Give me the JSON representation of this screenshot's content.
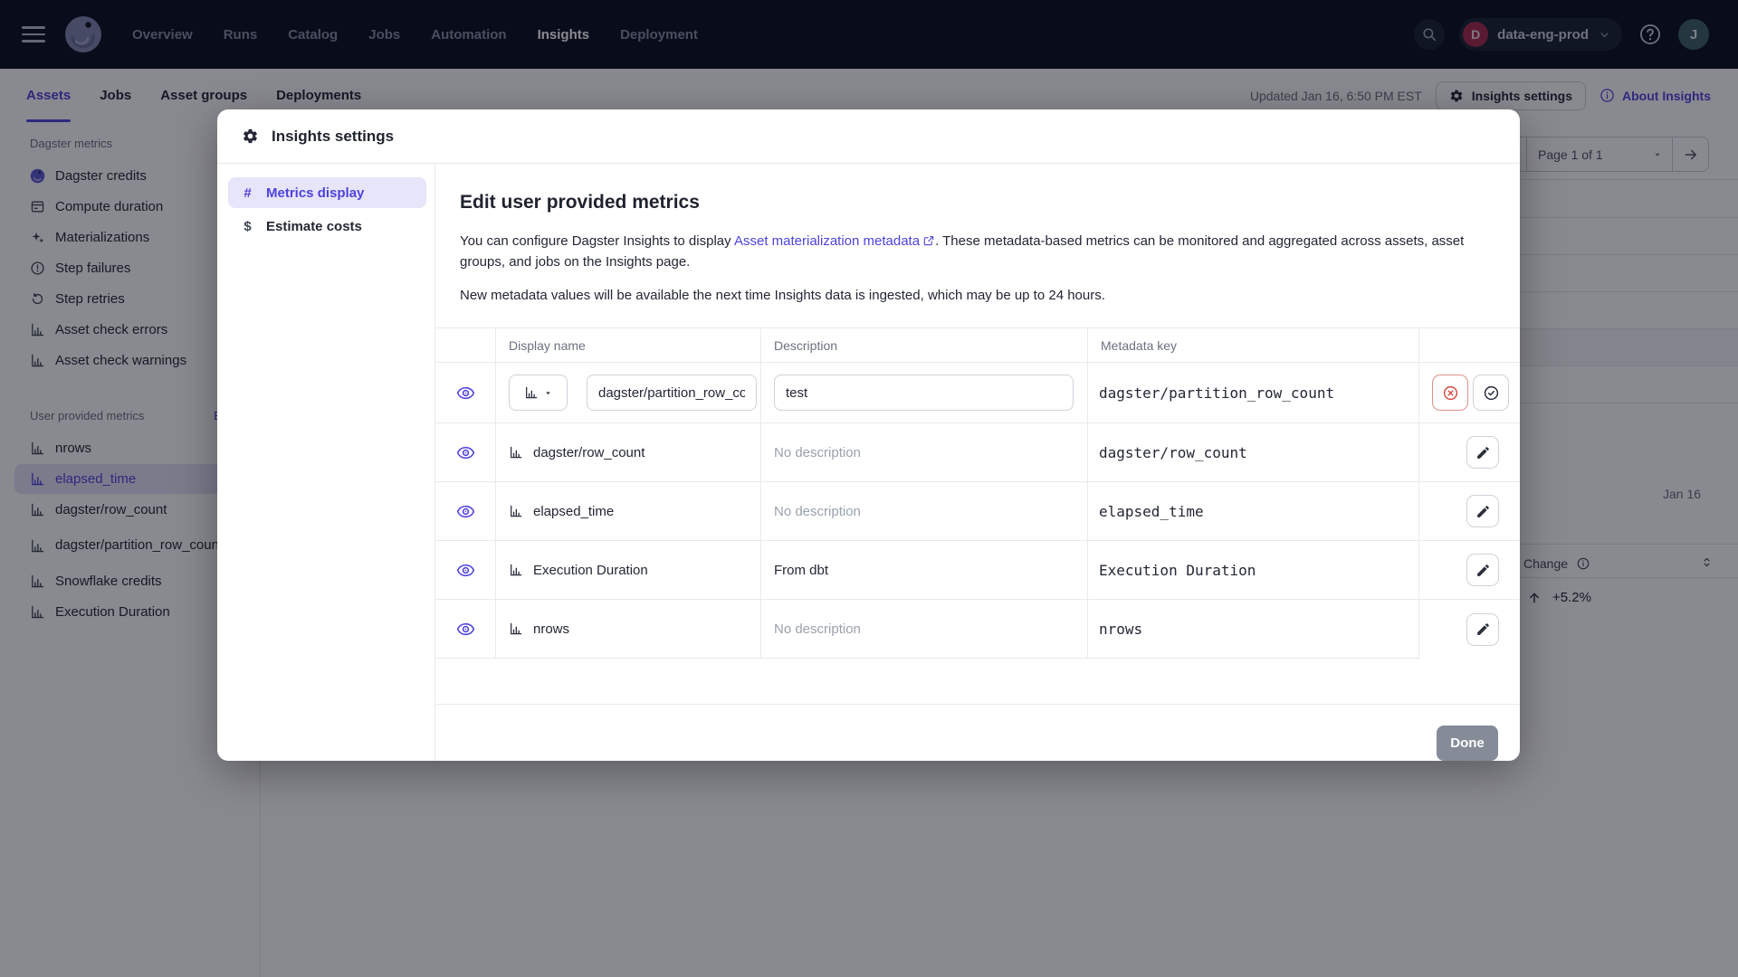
{
  "colors": {
    "accent": "#4f43dd",
    "accent_soft": "#e7e5fa",
    "danger": "#d8493e",
    "topnav_bg": "#0b0f1d",
    "org_badge": "#a62b4c",
    "avatar": "#3e6168",
    "done_button": "#858c98",
    "divider": "#e7e9ec"
  },
  "icons": {
    "logo": "dagster-octopus",
    "search": "magnifier",
    "help": "question-circle",
    "metric": "bar-chart",
    "visible": "eye",
    "edit": "pencil",
    "cancel": "circle-x",
    "confirm": "circle-check"
  },
  "topnav": {
    "items": [
      "Overview",
      "Runs",
      "Catalog",
      "Jobs",
      "Automation",
      "Insights",
      "Deployment"
    ],
    "active": "Insights",
    "org": {
      "initial": "D",
      "name": "data-eng-prod"
    },
    "avatar_initial": "J"
  },
  "tabsbar": {
    "tabs": [
      "Assets",
      "Jobs",
      "Asset groups",
      "Deployments"
    ],
    "active": "Assets",
    "updated": "Updated Jan 16, 6:50 PM EST",
    "settings_button": "Insights settings",
    "about_link": "About Insights"
  },
  "sidebar": {
    "sections": [
      {
        "title": "Dagster metrics",
        "items": [
          {
            "label": "Dagster credits"
          },
          {
            "label": "Compute duration"
          },
          {
            "label": "Materializations"
          },
          {
            "label": "Step failures"
          },
          {
            "label": "Step retries"
          },
          {
            "label": "Asset check errors"
          },
          {
            "label": "Asset check warnings"
          }
        ]
      },
      {
        "title": "User provided metrics",
        "edit_label": "Edit",
        "items": [
          {
            "label": "nrows"
          },
          {
            "label": "elapsed_time",
            "selected": true
          },
          {
            "label": "dagster/row_count"
          },
          {
            "label": "dagster/partition_row_count"
          },
          {
            "label": "Snowflake credits"
          },
          {
            "label": "Execution Duration"
          }
        ]
      }
    ]
  },
  "background_page": {
    "pagination": "Page 1 of 1",
    "axis_label": "Jan 16",
    "change_label": "Change",
    "change_value": "+5.2%"
  },
  "modal": {
    "title": "Insights settings",
    "nav": [
      {
        "icon": "#",
        "label": "Metrics display"
      },
      {
        "icon": "$",
        "label": "Estimate costs"
      }
    ],
    "heading": "Edit user provided metrics",
    "intro_before_link": "You can configure Dagster Insights to display ",
    "intro_link": "Asset materialization metadata",
    "intro_after_link": ". These metadata-based metrics can be monitored and aggregated across assets, asset groups, and jobs on the Insights page.",
    "intro2": "New metadata values will be available the next time Insights data is ingested, which may be up to 24 hours.",
    "table": {
      "headers": [
        "Display name",
        "Description",
        "Metadata key"
      ],
      "edit_row": {
        "name_value": "dagster/partition_row_count",
        "description_value": "test",
        "metadata_key": "dagster/partition_row_count"
      },
      "rows": [
        {
          "name": "dagster/row_count",
          "description": "No description",
          "metadata_key": "dagster/row_count"
        },
        {
          "name": "elapsed_time",
          "description": "No description",
          "metadata_key": "elapsed_time"
        },
        {
          "name": "Execution Duration",
          "description": "From dbt",
          "metadata_key": "Execution Duration"
        },
        {
          "name": "nrows",
          "description": "No description",
          "metadata_key": "nrows"
        }
      ]
    },
    "done_label": "Done"
  }
}
